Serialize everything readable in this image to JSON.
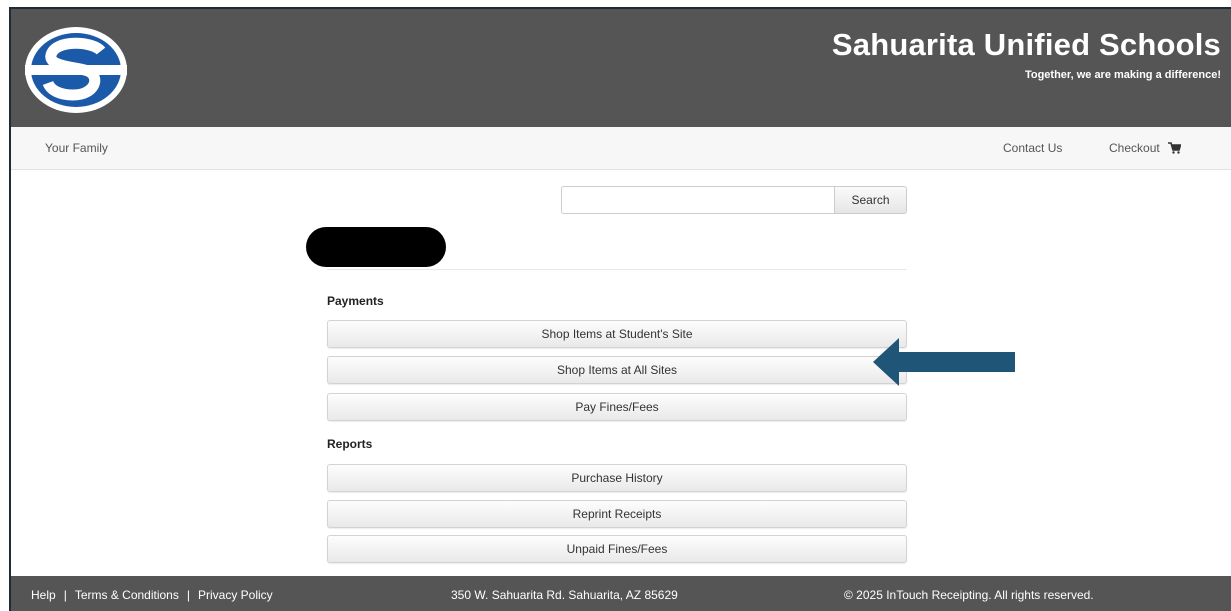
{
  "header": {
    "title": "Sahuarita Unified Schools",
    "tagline": "Together, we are making a difference!",
    "colors": {
      "header_bg": "#555555",
      "logo_blue": "#1a5aa8"
    }
  },
  "nav": {
    "family": "Your Family",
    "contact": "Contact Us",
    "checkout": "Checkout"
  },
  "search": {
    "value": "",
    "placeholder": "",
    "button": "Search"
  },
  "payments": {
    "title": "Payments",
    "items": [
      "Shop Items at Student's Site",
      "Shop Items at All Sites",
      "Pay Fines/Fees"
    ]
  },
  "reports": {
    "title": "Reports",
    "items": [
      "Purchase History",
      "Reprint Receipts",
      "Unpaid Fines/Fees"
    ]
  },
  "annotation": {
    "arrow_color": "#1f5577"
  },
  "footer": {
    "help": "Help",
    "sep": "|",
    "terms": "Terms & Conditions",
    "privacy": "Privacy Policy",
    "address": "350 W. Sahuarita Rd. Sahuarita, AZ 85629",
    "copyright": "© 2025 InTouch Receipting. All rights reserved."
  }
}
